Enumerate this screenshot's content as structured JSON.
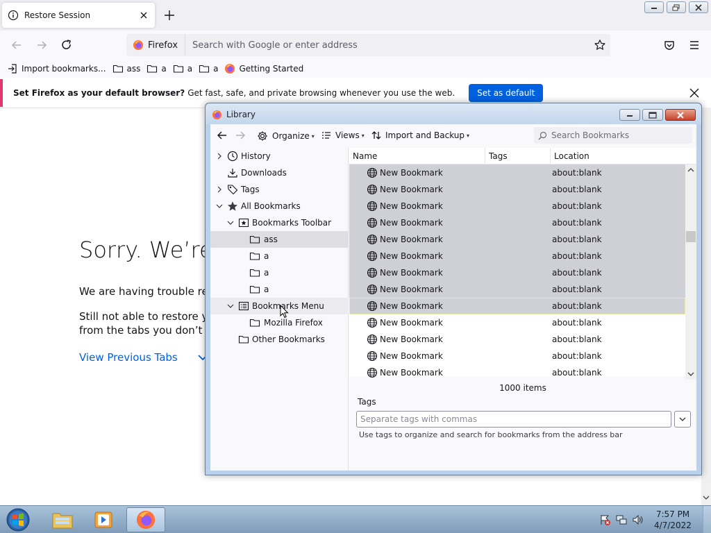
{
  "browser": {
    "tab": {
      "title": "Restore Session"
    },
    "urlbar": {
      "badge": "Firefox",
      "placeholder": "Search with Google or enter address"
    },
    "bookmarks_bar": [
      {
        "label": "Import bookmarks...",
        "icon": "import-icon"
      },
      {
        "label": "ass",
        "icon": "folder-icon"
      },
      {
        "label": "a",
        "icon": "folder-icon"
      },
      {
        "label": "a",
        "icon": "folder-icon"
      },
      {
        "label": "a",
        "icon": "folder-icon"
      },
      {
        "label": "Getting Started",
        "icon": "firefox-icon"
      }
    ],
    "notification": {
      "bold": "Set Firefox as your default browser?",
      "text": "Get fast, safe, and private browsing whenever you use the web.",
      "button": "Set as default",
      "accent": "#e1386f"
    },
    "content": {
      "title": "Sorry. We’re h",
      "p1": "We are having trouble resto",
      "p2_line1": "Still not able to restore you",
      "p2_line2": "from the tabs you don’t nee",
      "view_previous": "View Previous Tabs"
    }
  },
  "library": {
    "title": "Library",
    "toolbar": {
      "organize": "Organize",
      "views": "Views",
      "import_backup": "Import and Backup",
      "search_placeholder": "Search Bookmarks"
    },
    "tree": [
      {
        "label": "History",
        "icon": "clock-icon",
        "twisty": "right",
        "depth": 0
      },
      {
        "label": "Downloads",
        "icon": "download-icon",
        "twisty": "none",
        "depth": 0
      },
      {
        "label": "Tags",
        "icon": "tag-icon",
        "twisty": "right",
        "depth": 0
      },
      {
        "label": "All Bookmarks",
        "icon": "star-icon",
        "twisty": "down",
        "depth": 0
      },
      {
        "label": "Bookmarks Toolbar",
        "icon": "bookmarks-toolbar-icon",
        "twisty": "down",
        "depth": 1
      },
      {
        "label": "ass",
        "icon": "folder-icon",
        "twisty": "none",
        "depth": 2,
        "selected": true
      },
      {
        "label": "a",
        "icon": "folder-icon",
        "twisty": "none",
        "depth": 2
      },
      {
        "label": "a",
        "icon": "folder-icon",
        "twisty": "none",
        "depth": 2
      },
      {
        "label": "a",
        "icon": "folder-icon",
        "twisty": "none",
        "depth": 2
      },
      {
        "label": "Bookmarks Menu",
        "icon": "bookmarks-menu-icon",
        "twisty": "down",
        "depth": 1,
        "hover": true
      },
      {
        "label": "Mozilla Firefox",
        "icon": "folder-icon",
        "twisty": "none",
        "depth": 2
      },
      {
        "label": "Other Bookmarks",
        "icon": "folder-icon",
        "twisty": "none",
        "depth": 1
      }
    ],
    "columns": [
      "Name",
      "Tags",
      "Location"
    ],
    "rows": [
      {
        "name": "New Bookmark",
        "tags": "",
        "location": "about:blank",
        "selected": true
      },
      {
        "name": "New Bookmark",
        "tags": "",
        "location": "about:blank",
        "selected": true
      },
      {
        "name": "New Bookmark",
        "tags": "",
        "location": "about:blank",
        "selected": true
      },
      {
        "name": "New Bookmark",
        "tags": "",
        "location": "about:blank",
        "selected": true
      },
      {
        "name": "New Bookmark",
        "tags": "",
        "location": "about:blank",
        "selected": true
      },
      {
        "name": "New Bookmark",
        "tags": "",
        "location": "about:blank",
        "selected": true
      },
      {
        "name": "New Bookmark",
        "tags": "",
        "location": "about:blank",
        "selected": true
      },
      {
        "name": "New Bookmark",
        "tags": "",
        "location": "about:blank",
        "selected": true
      },
      {
        "name": "New Bookmark",
        "tags": "",
        "location": "about:blank",
        "selected": true,
        "focused": true
      },
      {
        "name": "New Bookmark",
        "tags": "",
        "location": "about:blank"
      },
      {
        "name": "New Bookmark",
        "tags": "",
        "location": "about:blank"
      },
      {
        "name": "New Bookmark",
        "tags": "",
        "location": "about:blank"
      },
      {
        "name": "New Bookmark",
        "tags": "",
        "location": "about:blank"
      }
    ],
    "items_count": "1000 items",
    "tags_label": "Tags",
    "tags_placeholder": "Separate tags with commas",
    "tags_help": "Use tags to organize and search for bookmarks from the address bar"
  },
  "taskbar": {
    "apps": [
      "windows-explorer-icon",
      "media-player-icon",
      "firefox-icon"
    ],
    "time": "7:57 PM",
    "date": "4/7/2022"
  }
}
